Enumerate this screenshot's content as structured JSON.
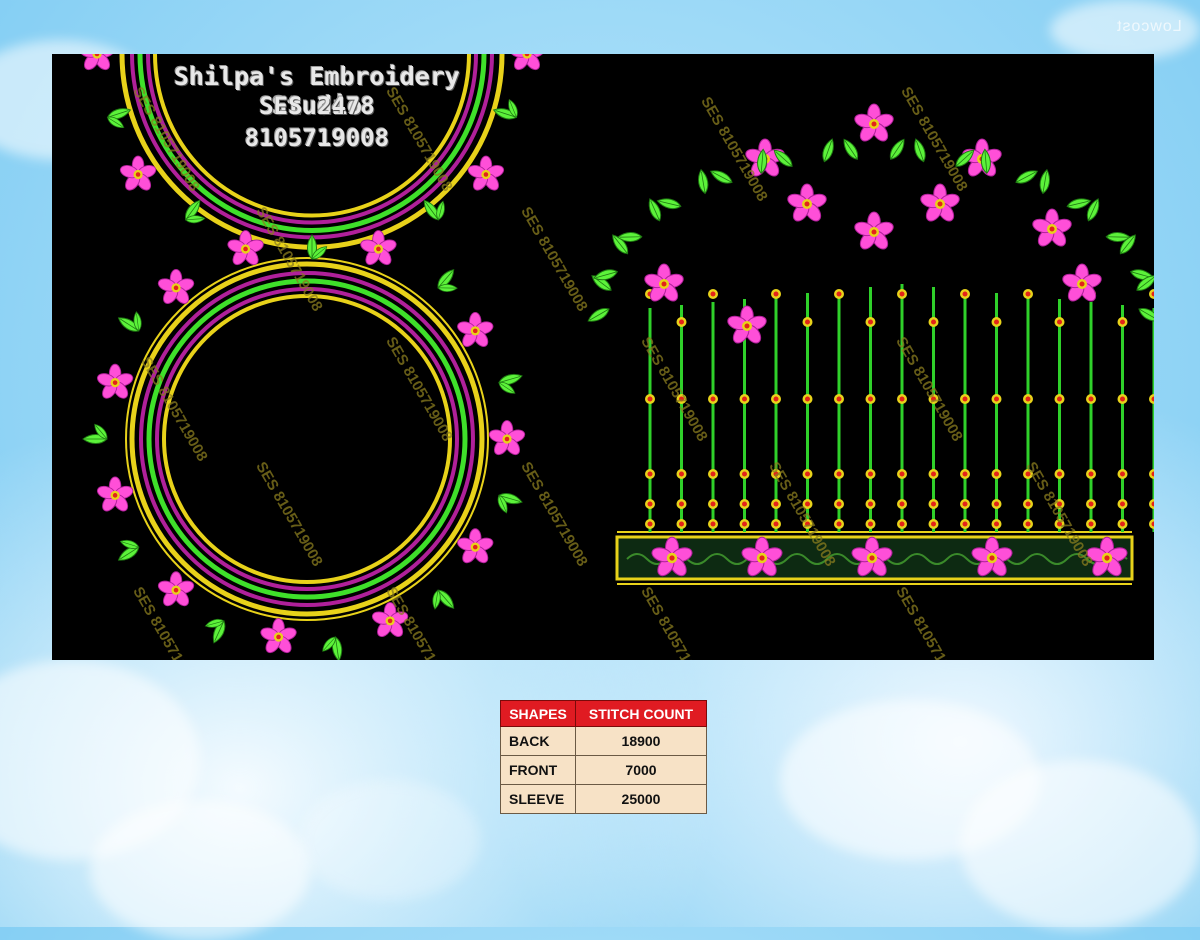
{
  "header": {
    "studio_name": "Shilpa's Embroidery Studio",
    "design_code": "SES 2478",
    "phone": "8105719008"
  },
  "watermark": {
    "text": "SES 8105719008",
    "site_mark": "Lowcost"
  },
  "colors": {
    "panel_bg": "#000000",
    "flower": "#ff4fd8",
    "leaf": "#5cf23a",
    "gold": "#e8d21a",
    "red": "#e2231a",
    "table_header": "#e01b22",
    "table_cell": "#f7e2c6"
  },
  "stitch_table": {
    "headers": [
      "SHAPES",
      "STITCH COUNT"
    ],
    "rows": [
      {
        "shape": "BACK",
        "count": "18900"
      },
      {
        "shape": "FRONT",
        "count": "7000"
      },
      {
        "shape": "SLEEVE",
        "count": "25000"
      }
    ]
  }
}
